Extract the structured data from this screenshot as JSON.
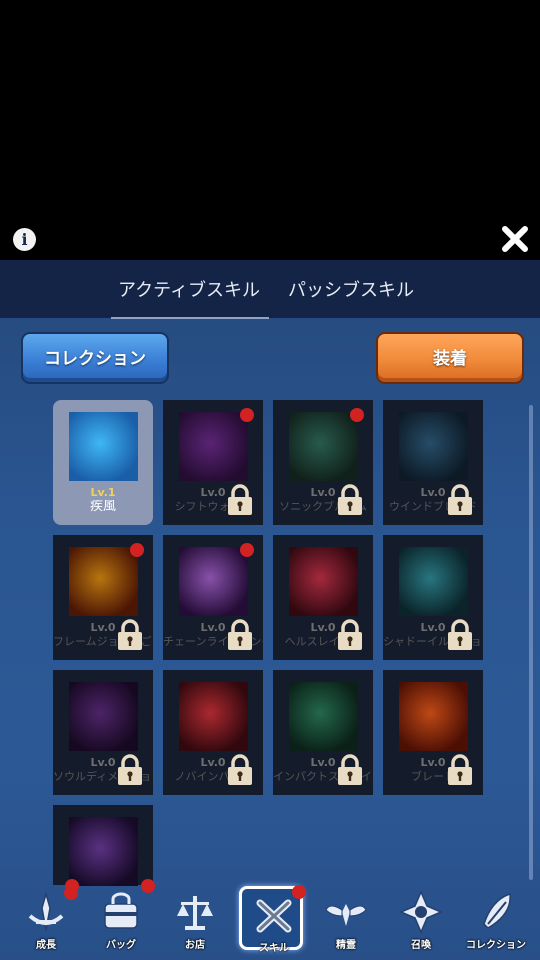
{
  "header": {
    "info_icon": "info-icon",
    "close_icon": "close-icon"
  },
  "tabs": [
    {
      "label": "アクティブスキル",
      "active": true
    },
    {
      "label": "パッシブスキル",
      "active": false
    }
  ],
  "buttons": {
    "collection": "コレクション",
    "equip": "装着"
  },
  "skills": [
    {
      "level": "Lv.1",
      "name": "疾風",
      "locked": false,
      "badge": false,
      "selected": true,
      "colors": [
        "#3fb7f5",
        "#1a5ea8"
      ]
    },
    {
      "level": "Lv.0",
      "name": "シフトウォーク",
      "locked": true,
      "badge": true,
      "selected": false,
      "colors": [
        "#6a2a8a",
        "#2a0e3a"
      ]
    },
    {
      "level": "Lv.0",
      "name": "ソニックブルーム",
      "locked": true,
      "badge": true,
      "selected": false,
      "colors": [
        "#2f6b5a",
        "#13261f"
      ]
    },
    {
      "level": "Lv.0",
      "name": "ウインドブレード",
      "locked": true,
      "badge": false,
      "selected": false,
      "colors": [
        "#2d5a7a",
        "#0f1f2d"
      ]
    },
    {
      "level": "Lv.0",
      "name": "フレームジョウのごと",
      "locked": true,
      "badge": true,
      "selected": false,
      "colors": [
        "#d88a12",
        "#5a1a05"
      ]
    },
    {
      "level": "Lv.0",
      "name": "チェーンライトニング",
      "locked": true,
      "badge": true,
      "selected": false,
      "colors": [
        "#a060c8",
        "#2a0e40"
      ]
    },
    {
      "level": "Lv.0",
      "name": "ヘルスレイヤー",
      "locked": true,
      "badge": false,
      "selected": false,
      "colors": [
        "#c03048",
        "#3a0a12"
      ]
    },
    {
      "level": "Lv.0",
      "name": "シャドーイルージョン",
      "locked": true,
      "badge": false,
      "selected": false,
      "colors": [
        "#2f8a96",
        "#0c2a30"
      ]
    },
    {
      "level": "Lv.0",
      "name": "ソウルディメンション",
      "locked": true,
      "badge": false,
      "selected": false,
      "colors": [
        "#5a2a7a",
        "#1a0a26"
      ]
    },
    {
      "level": "Lv.0",
      "name": "ノバインパクト",
      "locked": true,
      "badge": false,
      "selected": false,
      "colors": [
        "#c83038",
        "#3a0a10"
      ]
    },
    {
      "level": "Lv.0",
      "name": "インパクトストライク",
      "locked": true,
      "badge": false,
      "selected": false,
      "colors": [
        "#2a7a5a",
        "#0c261c"
      ]
    },
    {
      "level": "Lv.0",
      "name": "ブレード",
      "locked": true,
      "badge": false,
      "selected": false,
      "colors": [
        "#e0551a",
        "#5a1205"
      ]
    },
    {
      "level": "",
      "name": "",
      "locked": false,
      "badge": true,
      "selected": false,
      "colors": [
        "#6a3a9a",
        "#1a0c2e"
      ]
    }
  ],
  "nav": [
    {
      "label": "成長",
      "icon": "sword-icon",
      "badge": true,
      "active": false
    },
    {
      "label": "バッグ",
      "icon": "bag-icon",
      "badge": false,
      "active": false
    },
    {
      "label": "お店",
      "icon": "scale-icon",
      "badge": false,
      "active": false
    },
    {
      "label": "スキル",
      "icon": "skill-cross-icon",
      "badge": true,
      "active": true
    },
    {
      "label": "精霊",
      "icon": "wings-icon",
      "badge": false,
      "active": false
    },
    {
      "label": "召喚",
      "icon": "star-emblem-icon",
      "badge": false,
      "active": false
    },
    {
      "label": "コレクション",
      "icon": "feather-icon",
      "badge": false,
      "active": false
    }
  ],
  "colors": {
    "badge": "#d32222",
    "panel": "#2a5590",
    "tabbar": "#142447"
  }
}
